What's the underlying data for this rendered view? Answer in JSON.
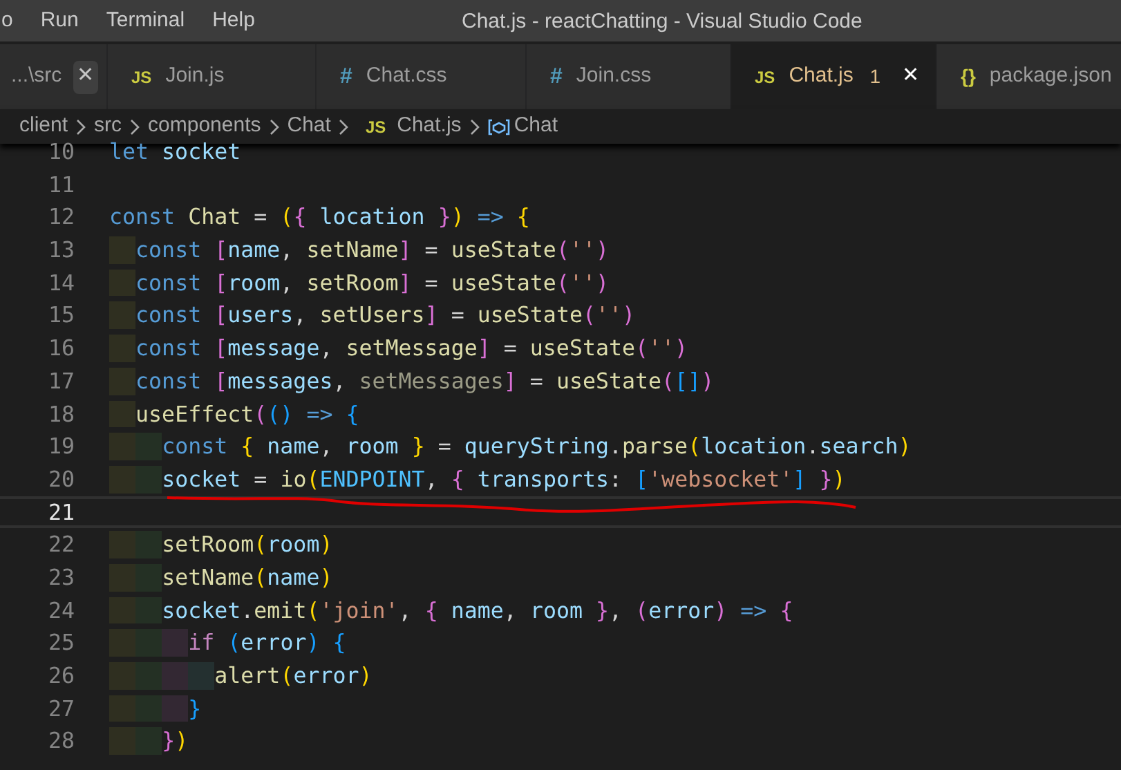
{
  "menu": [
    "o",
    "Run",
    "Terminal",
    "Help"
  ],
  "window": {
    "title": "Chat.js - reactChatting - Visual Studio Code"
  },
  "tabs": [
    {
      "label": "...\\src",
      "selected": false,
      "close": "✕"
    },
    {
      "label": "Join.js",
      "icon": "JS",
      "kind": "js",
      "selected": false
    },
    {
      "label": "Chat.css",
      "icon": "#",
      "kind": "css",
      "selected": false
    },
    {
      "label": "Join.css",
      "icon": "#",
      "kind": "css",
      "selected": false
    },
    {
      "label": "Chat.js",
      "icon": "JS",
      "kind": "js",
      "selected": true,
      "close": "✕",
      "badge": "1"
    },
    {
      "label": "package.json",
      "icon": "{}",
      "kind": "json",
      "selected": false
    }
  ],
  "breadcrumb": [
    {
      "label": "client"
    },
    {
      "label": "src"
    },
    {
      "label": "components"
    },
    {
      "label": "Chat"
    },
    {
      "label": "Chat.js",
      "icon": "JS"
    },
    {
      "label": "Chat",
      "kind": "symbol"
    }
  ],
  "lines": [
    {
      "number": "10",
      "current": false,
      "tokens": [
        {
          "text": "let ",
          "kind": "kw"
        },
        {
          "text": "socket",
          "kind": "var"
        }
      ]
    },
    {
      "number": "11",
      "current": false
    },
    {
      "number": "12",
      "current": false,
      "tokens": [
        {
          "text": "const ",
          "kind": "kw"
        },
        {
          "text": "Chat",
          "kind": "fn"
        },
        {
          "text": " = ",
          "kind": "p"
        },
        {
          "text": "(",
          "kind": "b1"
        },
        {
          "text": "{",
          "kind": "b2"
        },
        {
          "text": " location ",
          "kind": "var"
        },
        {
          "text": "}",
          "kind": "b2"
        },
        {
          "text": ")",
          "kind": "b1"
        },
        {
          "text": " => ",
          "kind": "kw"
        },
        {
          "text": "{",
          "kind": "b1"
        }
      ]
    },
    {
      "number": "13",
      "current": false,
      "tokens": [
        {
          "text": "  const ",
          "kind": "kw"
        },
        {
          "text": "[",
          "kind": "b2"
        },
        {
          "text": "name",
          "kind": "var"
        },
        {
          "text": ", ",
          "kind": "p"
        },
        {
          "text": "setName",
          "kind": "fn"
        },
        {
          "text": "]",
          "kind": "b2"
        },
        {
          "text": " = ",
          "kind": "p"
        },
        {
          "text": "useState",
          "kind": "fn"
        },
        {
          "text": "(",
          "kind": "b2"
        },
        {
          "text": "''",
          "kind": "str"
        },
        {
          "text": ")",
          "kind": "b2"
        }
      ]
    },
    {
      "number": "14",
      "current": false,
      "tokens": [
        {
          "text": "  const ",
          "kind": "kw"
        },
        {
          "text": "[",
          "kind": "b2"
        },
        {
          "text": "room",
          "kind": "var"
        },
        {
          "text": ", ",
          "kind": "p"
        },
        {
          "text": "setRoom",
          "kind": "fn"
        },
        {
          "text": "]",
          "kind": "b2"
        },
        {
          "text": " = ",
          "kind": "p"
        },
        {
          "text": "useState",
          "kind": "fn"
        },
        {
          "text": "(",
          "kind": "b2"
        },
        {
          "text": "''",
          "kind": "str"
        },
        {
          "text": ")",
          "kind": "b2"
        }
      ]
    },
    {
      "number": "15",
      "current": false,
      "tokens": [
        {
          "text": "  const ",
          "kind": "kw"
        },
        {
          "text": "[",
          "kind": "b2"
        },
        {
          "text": "users",
          "kind": "var"
        },
        {
          "text": ", ",
          "kind": "p"
        },
        {
          "text": "setUsers",
          "kind": "fn"
        },
        {
          "text": "]",
          "kind": "b2"
        },
        {
          "text": " = ",
          "kind": "p"
        },
        {
          "text": "useState",
          "kind": "fn"
        },
        {
          "text": "(",
          "kind": "b2"
        },
        {
          "text": "''",
          "kind": "str"
        },
        {
          "text": ")",
          "kind": "b2"
        }
      ]
    },
    {
      "number": "16",
      "current": false,
      "tokens": [
        {
          "text": "  const ",
          "kind": "kw"
        },
        {
          "text": "[",
          "kind": "b2"
        },
        {
          "text": "message",
          "kind": "var"
        },
        {
          "text": ", ",
          "kind": "p"
        },
        {
          "text": "setMessage",
          "kind": "fn"
        },
        {
          "text": "]",
          "kind": "b2"
        },
        {
          "text": " = ",
          "kind": "p"
        },
        {
          "text": "useState",
          "kind": "fn"
        },
        {
          "text": "(",
          "kind": "b2"
        },
        {
          "text": "''",
          "kind": "str"
        },
        {
          "text": ")",
          "kind": "b2"
        }
      ]
    },
    {
      "number": "17",
      "current": false,
      "tokens": [
        {
          "text": "  const ",
          "kind": "kw"
        },
        {
          "text": "[",
          "kind": "b2"
        },
        {
          "text": "messages",
          "kind": "var"
        },
        {
          "text": ", ",
          "kind": "p"
        },
        {
          "text": "setMessages",
          "kind": "dim"
        },
        {
          "text": "]",
          "kind": "b2"
        },
        {
          "text": " = ",
          "kind": "p"
        },
        {
          "text": "useState",
          "kind": "fn"
        },
        {
          "text": "(",
          "kind": "b2"
        },
        {
          "text": "[]",
          "kind": "b3"
        },
        {
          "text": ")",
          "kind": "b2"
        }
      ]
    },
    {
      "number": "18",
      "current": false,
      "tokens": [
        {
          "text": "  useEffect",
          "kind": "fn"
        },
        {
          "text": "(",
          "kind": "b2"
        },
        {
          "text": "()",
          "kind": "b3"
        },
        {
          "text": " => ",
          "kind": "kw"
        },
        {
          "text": "{",
          "kind": "b3"
        }
      ]
    },
    {
      "number": "19",
      "current": false,
      "tokens": [
        {
          "text": "    const ",
          "kind": "kw"
        },
        {
          "text": "{",
          "kind": "b1"
        },
        {
          "text": " name",
          "kind": "var"
        },
        {
          "text": ", ",
          "kind": "p"
        },
        {
          "text": "room ",
          "kind": "var"
        },
        {
          "text": "}",
          "kind": "b1"
        },
        {
          "text": " = ",
          "kind": "p"
        },
        {
          "text": "queryString",
          "kind": "var"
        },
        {
          "text": ".",
          "kind": "p"
        },
        {
          "text": "parse",
          "kind": "fn"
        },
        {
          "text": "(",
          "kind": "b1"
        },
        {
          "text": "location",
          "kind": "var"
        },
        {
          "text": ".",
          "kind": "p"
        },
        {
          "text": "search",
          "kind": "var"
        },
        {
          "text": ")",
          "kind": "b1"
        }
      ]
    },
    {
      "number": "20",
      "current": false,
      "tokens": [
        {
          "text": "    socket",
          "kind": "var"
        },
        {
          "text": " = ",
          "kind": "p"
        },
        {
          "text": "io",
          "kind": "fn"
        },
        {
          "text": "(",
          "kind": "b1"
        },
        {
          "text": "ENDPOINT",
          "kind": "const"
        },
        {
          "text": ", ",
          "kind": "p"
        },
        {
          "text": "{",
          "kind": "b2"
        },
        {
          "text": " transports",
          "kind": "var"
        },
        {
          "text": ": ",
          "kind": "p"
        },
        {
          "text": "[",
          "kind": "b3"
        },
        {
          "text": "'websocket'",
          "kind": "str"
        },
        {
          "text": "] ",
          "kind": "b3"
        },
        {
          "text": "}",
          "kind": "b2"
        },
        {
          "text": ")",
          "kind": "b1"
        }
      ]
    },
    {
      "number": "21",
      "current": true
    },
    {
      "number": "22",
      "current": false,
      "tokens": [
        {
          "text": "    setRoom",
          "kind": "fn"
        },
        {
          "text": "(",
          "kind": "b1"
        },
        {
          "text": "room",
          "kind": "var"
        },
        {
          "text": ")",
          "kind": "b1"
        }
      ]
    },
    {
      "number": "23",
      "current": false,
      "tokens": [
        {
          "text": "    setName",
          "kind": "fn"
        },
        {
          "text": "(",
          "kind": "b1"
        },
        {
          "text": "name",
          "kind": "var"
        },
        {
          "text": ")",
          "kind": "b1"
        }
      ]
    },
    {
      "number": "24",
      "current": false,
      "tokens": [
        {
          "text": "    socket",
          "kind": "var"
        },
        {
          "text": ".",
          "kind": "p"
        },
        {
          "text": "emit",
          "kind": "fn"
        },
        {
          "text": "(",
          "kind": "b1"
        },
        {
          "text": "'join'",
          "kind": "str"
        },
        {
          "text": ", ",
          "kind": "p"
        },
        {
          "text": "{",
          "kind": "b2"
        },
        {
          "text": " name",
          "kind": "var"
        },
        {
          "text": ", ",
          "kind": "p"
        },
        {
          "text": "room ",
          "kind": "var"
        },
        {
          "text": "}",
          "kind": "b2"
        },
        {
          "text": ", ",
          "kind": "p"
        },
        {
          "text": "(",
          "kind": "b2"
        },
        {
          "text": "error",
          "kind": "var"
        },
        {
          "text": ")",
          "kind": "b2"
        },
        {
          "text": " => ",
          "kind": "kw"
        },
        {
          "text": "{",
          "kind": "b2"
        }
      ]
    },
    {
      "number": "25",
      "current": false,
      "tokens": [
        {
          "text": "      if ",
          "kind": "ctl"
        },
        {
          "text": "(",
          "kind": "b3"
        },
        {
          "text": "error",
          "kind": "var"
        },
        {
          "text": ") ",
          "kind": "b3"
        },
        {
          "text": "{",
          "kind": "b3"
        }
      ]
    },
    {
      "number": "26",
      "current": false,
      "tokens": [
        {
          "text": "        alert",
          "kind": "fn"
        },
        {
          "text": "(",
          "kind": "b1"
        },
        {
          "text": "error",
          "kind": "var"
        },
        {
          "text": ")",
          "kind": "b1"
        }
      ]
    },
    {
      "number": "27",
      "current": false,
      "tokens": [
        {
          "text": "      }",
          "kind": "b3"
        }
      ]
    },
    {
      "number": "28",
      "current": false,
      "tokens": [
        {
          "text": "    }",
          "kind": "b2"
        },
        {
          "text": ")",
          "kind": "b1"
        }
      ]
    }
  ]
}
